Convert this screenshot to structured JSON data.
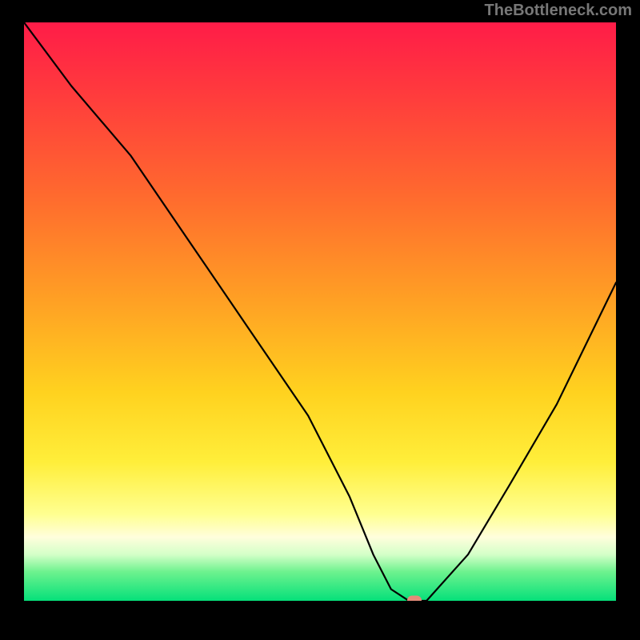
{
  "watermark": "TheBottleneck.com",
  "chart_data": {
    "type": "line",
    "title": "",
    "xlabel": "",
    "ylabel": "",
    "xlim": [
      0,
      100
    ],
    "ylim": [
      0,
      100
    ],
    "series": [
      {
        "name": "bottleneck-curve",
        "x": [
          0,
          8,
          18,
          28,
          38,
          48,
          55,
          59,
          62,
          65,
          68,
          75,
          82,
          90,
          100
        ],
        "y": [
          100,
          89,
          77,
          62,
          47,
          32,
          18,
          8,
          2,
          0,
          0,
          8,
          20,
          34,
          55
        ]
      }
    ],
    "marker": {
      "x": 66,
      "y": 0,
      "color": "#e48b79"
    },
    "gradient_stops": [
      {
        "pos": 0,
        "color": "#ff1c48"
      },
      {
        "pos": 12,
        "color": "#ff3a3d"
      },
      {
        "pos": 30,
        "color": "#ff6a2e"
      },
      {
        "pos": 48,
        "color": "#ffa024"
      },
      {
        "pos": 64,
        "color": "#ffd21f"
      },
      {
        "pos": 76,
        "color": "#ffee3a"
      },
      {
        "pos": 85,
        "color": "#ffff90"
      },
      {
        "pos": 89,
        "color": "#fffedc"
      },
      {
        "pos": 92,
        "color": "#d4ffc8"
      },
      {
        "pos": 95,
        "color": "#6df28e"
      },
      {
        "pos": 100,
        "color": "#05e07a"
      }
    ]
  }
}
